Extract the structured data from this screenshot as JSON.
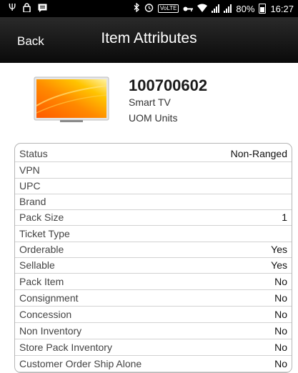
{
  "statusbar": {
    "left_icons": [
      "usb-icon",
      "lock-icon",
      "message-icon"
    ],
    "right_icons": [
      "bluetooth-icon",
      "alarm-icon",
      "volte-icon",
      "key-icon",
      "wifi-icon",
      "signal-icon",
      "signal-icon",
      "battery-icon"
    ],
    "volte_label": "VoLTE",
    "battery_percent": "80%",
    "time": "16:27"
  },
  "header": {
    "back_label": "Back",
    "title": "Item Attributes"
  },
  "item": {
    "code": "100700602",
    "description": "Smart TV",
    "uom": "UOM Units"
  },
  "attributes": [
    {
      "label": "Status",
      "value": "Non-Ranged"
    },
    {
      "label": "VPN",
      "value": ""
    },
    {
      "label": "UPC",
      "value": ""
    },
    {
      "label": "Brand",
      "value": ""
    },
    {
      "label": "Pack Size",
      "value": "1"
    },
    {
      "label": "Ticket Type",
      "value": ""
    },
    {
      "label": "Orderable",
      "value": "Yes"
    },
    {
      "label": "Sellable",
      "value": "Yes"
    },
    {
      "label": "Pack Item",
      "value": "No"
    },
    {
      "label": "Consignment",
      "value": "No"
    },
    {
      "label": "Concession",
      "value": "No"
    },
    {
      "label": "Non Inventory",
      "value": "No"
    },
    {
      "label": "Store Pack Inventory",
      "value": "No"
    },
    {
      "label": "Customer Order Ship Alone",
      "value": "No"
    }
  ]
}
